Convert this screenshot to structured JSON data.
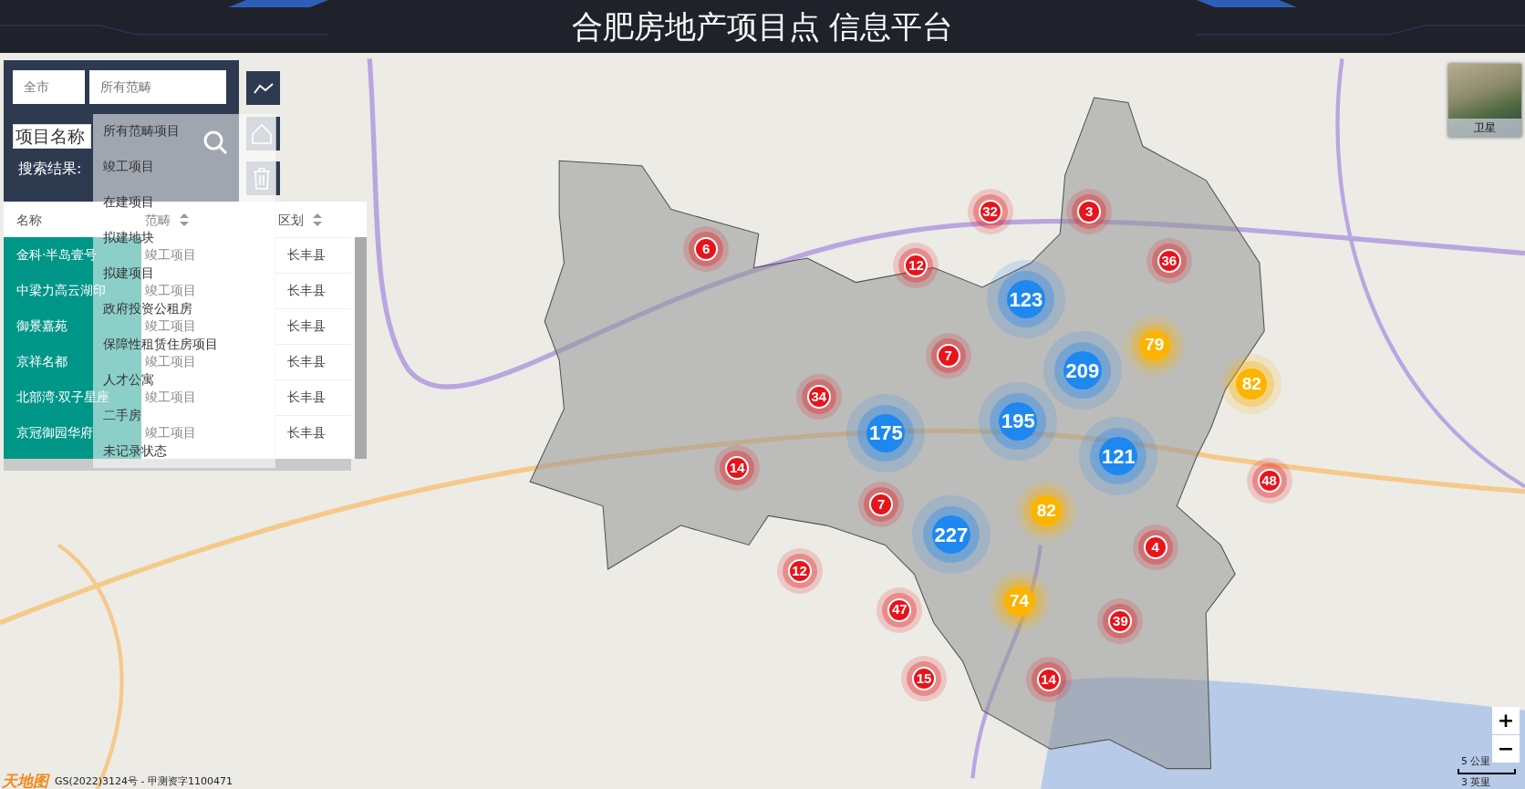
{
  "header": {
    "title": "合肥房地产项目点 信息平台"
  },
  "search_panel": {
    "city_select": {
      "value": "全市"
    },
    "category_select": {
      "value": "所有范畴",
      "expanded": true,
      "options": [
        {
          "label": "所有范畴项目",
          "selected": false
        },
        {
          "label": "竣工项目",
          "selected": false
        },
        {
          "label": "在建项目",
          "selected": false
        },
        {
          "label": "拟建地块",
          "selected": false
        },
        {
          "label": "拟建项目",
          "selected": false
        },
        {
          "label": "政府投资公租房",
          "selected": false
        },
        {
          "label": "保障性租赁住房项目",
          "selected": false
        },
        {
          "label": "人才公寓",
          "selected": false
        },
        {
          "label": "二手房",
          "selected": false
        },
        {
          "label": "未记录状态",
          "selected": false
        }
      ]
    },
    "name_field": {
      "placeholder": "项目名称"
    },
    "results_label": "搜索结果:"
  },
  "results_table": {
    "columns": [
      {
        "label": "名称",
        "sortable": false
      },
      {
        "label": "范畴",
        "sortable": true
      },
      {
        "label": "区划",
        "sortable": true
      }
    ],
    "rows": [
      {
        "name": "金科·半岛壹号",
        "category": "竣工项目",
        "district": "长丰县"
      },
      {
        "name": "中梁力高云湖印",
        "category": "竣工项目",
        "district": "长丰县"
      },
      {
        "name": "御景嘉苑",
        "category": "竣工项目",
        "district": "长丰县"
      },
      {
        "name": "京祥名都",
        "category": "竣工项目",
        "district": "长丰县"
      },
      {
        "name": "北部湾·双子星座",
        "category": "竣工项目",
        "district": "长丰县"
      },
      {
        "name": "京冠御园华府",
        "category": "竣工项目",
        "district": "长丰县"
      }
    ]
  },
  "markers": [
    {
      "count": "6",
      "kind": "small",
      "color": "#e8141b"
    },
    {
      "count": "32",
      "kind": "small",
      "color": "#e8141b"
    },
    {
      "count": "3",
      "kind": "small",
      "color": "#e8141b"
    },
    {
      "count": "12",
      "kind": "small",
      "color": "#e8141b"
    },
    {
      "count": "36",
      "kind": "small",
      "color": "#e8141b"
    },
    {
      "count": "123",
      "kind": "large",
      "color": "#1e88f0"
    },
    {
      "count": "79",
      "kind": "medium",
      "color": "#fbb400"
    },
    {
      "count": "7",
      "kind": "small",
      "color": "#e8141b"
    },
    {
      "count": "209",
      "kind": "large",
      "color": "#1e88f0"
    },
    {
      "count": "82",
      "kind": "medium",
      "color": "#fbb400"
    },
    {
      "count": "34",
      "kind": "small",
      "color": "#e8141b"
    },
    {
      "count": "175",
      "kind": "large",
      "color": "#1e88f0"
    },
    {
      "count": "195",
      "kind": "large",
      "color": "#1e88f0"
    },
    {
      "count": "121",
      "kind": "large",
      "color": "#1e88f0"
    },
    {
      "count": "14",
      "kind": "small",
      "color": "#e8141b"
    },
    {
      "count": "48",
      "kind": "small",
      "color": "#e8141b"
    },
    {
      "count": "7",
      "kind": "small",
      "color": "#e8141b"
    },
    {
      "count": "82",
      "kind": "medium",
      "color": "#fbb400"
    },
    {
      "count": "227",
      "kind": "large",
      "color": "#1e88f0"
    },
    {
      "count": "4",
      "kind": "small",
      "color": "#e8141b"
    },
    {
      "count": "12",
      "kind": "small",
      "color": "#e8141b"
    },
    {
      "count": "74",
      "kind": "medium",
      "color": "#fbb400"
    },
    {
      "count": "47",
      "kind": "small",
      "color": "#e8141b"
    },
    {
      "count": "39",
      "kind": "small",
      "color": "#e8141b"
    },
    {
      "count": "15",
      "kind": "small",
      "color": "#e8141b"
    },
    {
      "count": "14",
      "kind": "small",
      "color": "#e8141b"
    }
  ],
  "layer_switch": {
    "label": "卫星"
  },
  "zoom_controls": {
    "zoom_in": "+",
    "zoom_out": "−"
  },
  "scale_bar": {
    "metric": "5 公里",
    "imperial": "3 英里"
  },
  "attribution": {
    "logo": "天地图",
    "text": "GS(2022)3124号 - 甲测资字1100471"
  }
}
